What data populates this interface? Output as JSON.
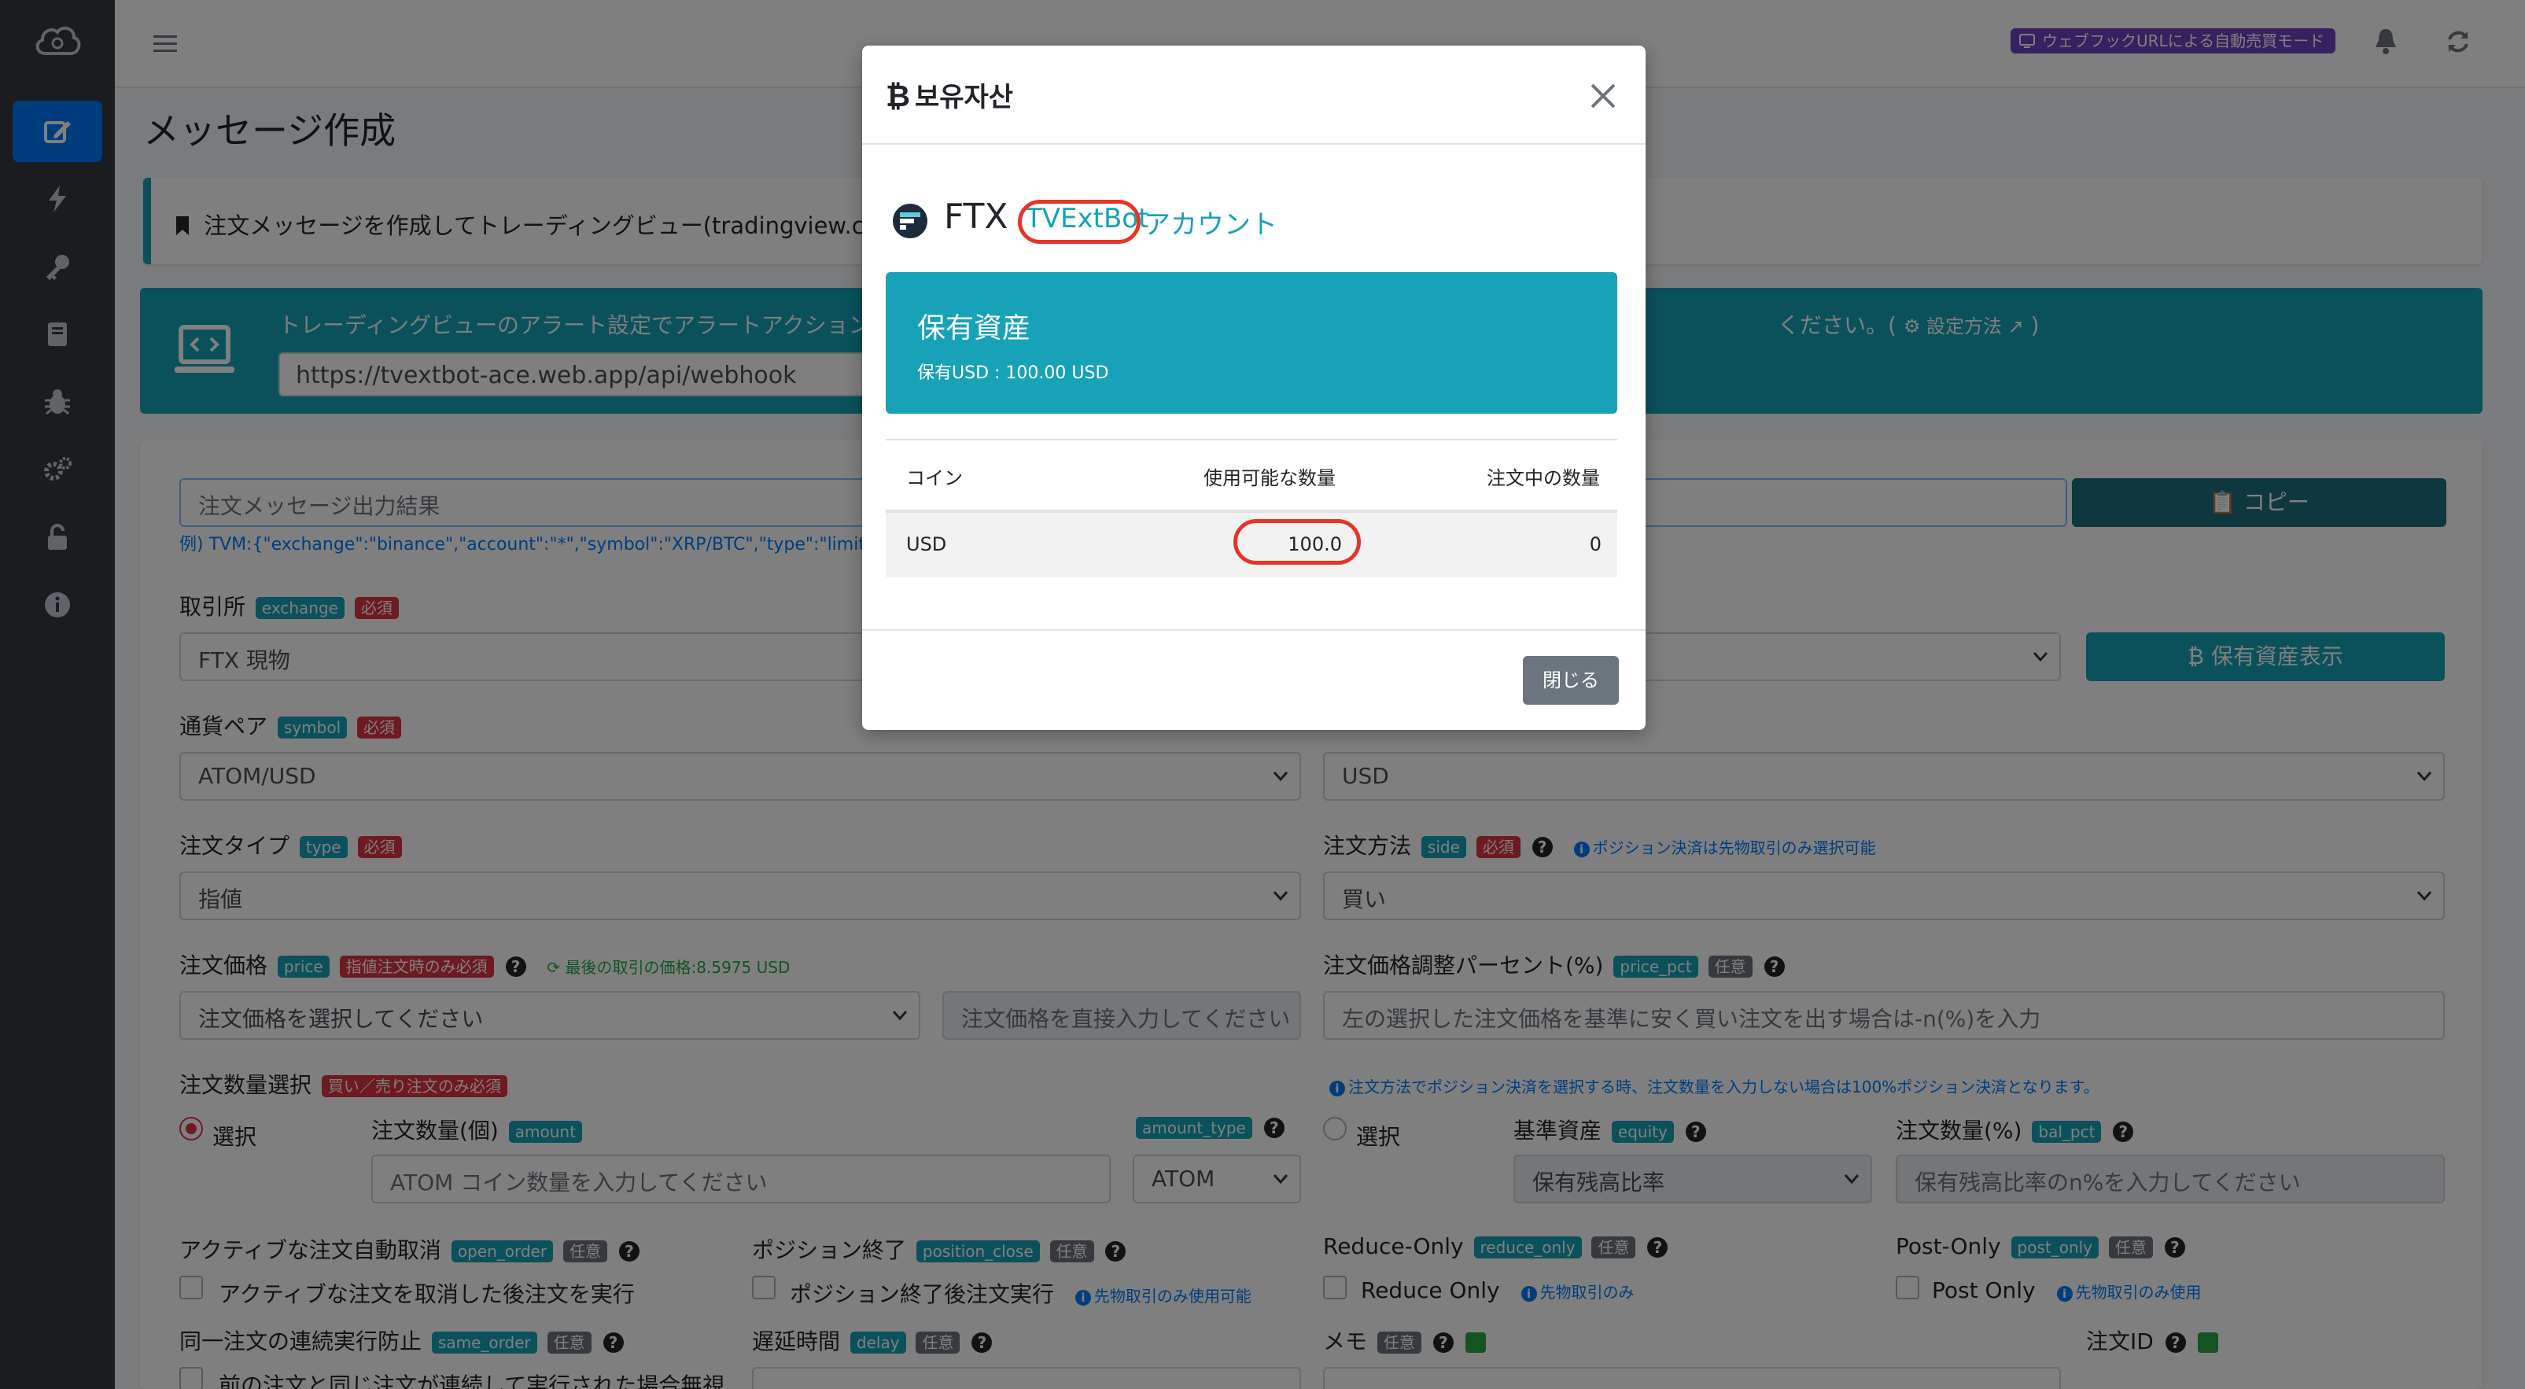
{
  "header": {
    "mode_badge": "ウェブフックURLによる自動売買モード"
  },
  "page": {
    "title": "メッセージ作成",
    "info_text": "注文メッセージを作成してトレーディングビュー(tradingview.com)の",
    "webhook_text_left": "トレーディングビューのアラート設定でアラートアクション",
    "webhook_text_right": "ください。(",
    "webhook_setup_link": "設定方法",
    "webhook_text_end": ")",
    "webhook_url": "https://tvextbot-ace.web.app/api/webhook"
  },
  "form": {
    "output_placeholder": "注文メッセージ出力結果",
    "copy_button": "コピー",
    "example": "例) TVM:{\"exchange\":\"binance\",\"account\":\"*\",\"symbol\":\"XRP/BTC\",\"type\":\"limit\",\"si",
    "exchange_label": "取引所",
    "exchange_badge": "exchange",
    "required": "必須",
    "optional": "任意",
    "exchange_value": "FTX 現物",
    "show_assets_button": "保有資産表示",
    "symbol_label": "通貨ペア",
    "symbol_badge": "symbol",
    "symbol_value": "ATOM/USD",
    "quote_value": "USD",
    "type_label": "注文タイプ",
    "type_badge": "type",
    "type_value": "指値",
    "side_label": "注文方法",
    "side_badge": "side",
    "side_hint": "ポジション決済は先物取引のみ選択可能",
    "side_value": "買い",
    "price_label": "注文価格",
    "price_badge": "price",
    "price_req": "指値注文時のみ必須",
    "last_price": "最後の取引の価格:8.5975 USD",
    "price_select": "注文価格を選択してください",
    "price_direct_ph": "注文価格を直接入力してください",
    "price_pct_label": "注文価格調整パーセント(%)",
    "price_pct_badge": "price_pct",
    "price_pct_ph": "左の選択した注文価格を基準に安く買い注文を出す場合は-n(%)を入力",
    "qty_select_label": "注文数量選択",
    "qty_select_req": "買い／売り注文のみ必須",
    "qty_hint": "注文方法でポジション決済を選択する時、注文数量を入力しない場合は100%ポジション決済となります。",
    "select_label": "選択",
    "amount_label": "注文数量(個)",
    "amount_badge": "amount",
    "amount_ph": "ATOM コイン数量を入力してください",
    "amount_type_badge": "amount_type",
    "amount_type_value": "ATOM",
    "equity_label": "基準資産",
    "equity_badge": "equity",
    "equity_value": "保有残高比率",
    "bal_pct_label": "注文数量(%)",
    "bal_pct_badge": "bal_pct",
    "bal_pct_ph": "保有残高比率のn%を入力してください",
    "open_order_label": "アクティブな注文自動取消",
    "open_order_badge": "open_order",
    "open_order_check": "アクティブな注文を取消した後注文を実行",
    "position_close_label": "ポジション終了",
    "position_close_badge": "position_close",
    "position_close_check": "ポジション終了後注文実行",
    "futures_only_use": "先物取引のみ使用可能",
    "reduce_only_label": "Reduce-Only",
    "reduce_only_badge": "reduce_only",
    "reduce_only_check": "Reduce Only",
    "futures_only": "先物取引のみ",
    "post_only_label": "Post-Only",
    "post_only_badge": "post_only",
    "post_only_check": "Post Only",
    "futures_only_use2": "先物取引のみ使用",
    "same_order_label": "同一注文の連続実行防止",
    "same_order_badge": "same_order",
    "same_order_check": "前の注文と同じ注文が連続して実行された場合無視",
    "delay_label": "遅延時間",
    "delay_badge": "delay",
    "memo_label": "メモ",
    "order_id_label": "注文ID"
  },
  "modal": {
    "title": "보유자산",
    "exchange": "FTX",
    "account_name": "TVExtBot",
    "account_suffix": "アカウント",
    "asset_title": "保有資産",
    "asset_usd": "保有USD : 100.00 USD",
    "table": {
      "headers": [
        "コイン",
        "使用可能な数量",
        "注文中の数量"
      ],
      "rows": [
        {
          "coin": "USD",
          "available": "100.0",
          "in_order": "0"
        }
      ]
    },
    "close_button": "閉じる"
  },
  "colors": {
    "sidebar": "#343a40",
    "primary": "#007bff",
    "info": "#17a2b8",
    "danger": "#dc3545",
    "highlight_ring": "#e53528"
  }
}
